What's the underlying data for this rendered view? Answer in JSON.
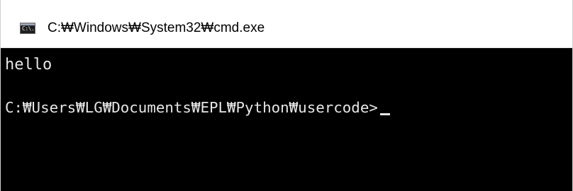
{
  "window": {
    "title": "C:₩Windows₩System32₩cmd.exe",
    "icon": "cmd-console-icon",
    "icon_glyph": "C:\\."
  },
  "console": {
    "output_line": "hello",
    "prompt": "C:₩Users₩LG₩Documents₩EPL₩Python₩usercode>"
  },
  "colors": {
    "console_background": "#000000",
    "console_text": "#e6e6e6",
    "titlebar_background": "#ffffff"
  }
}
